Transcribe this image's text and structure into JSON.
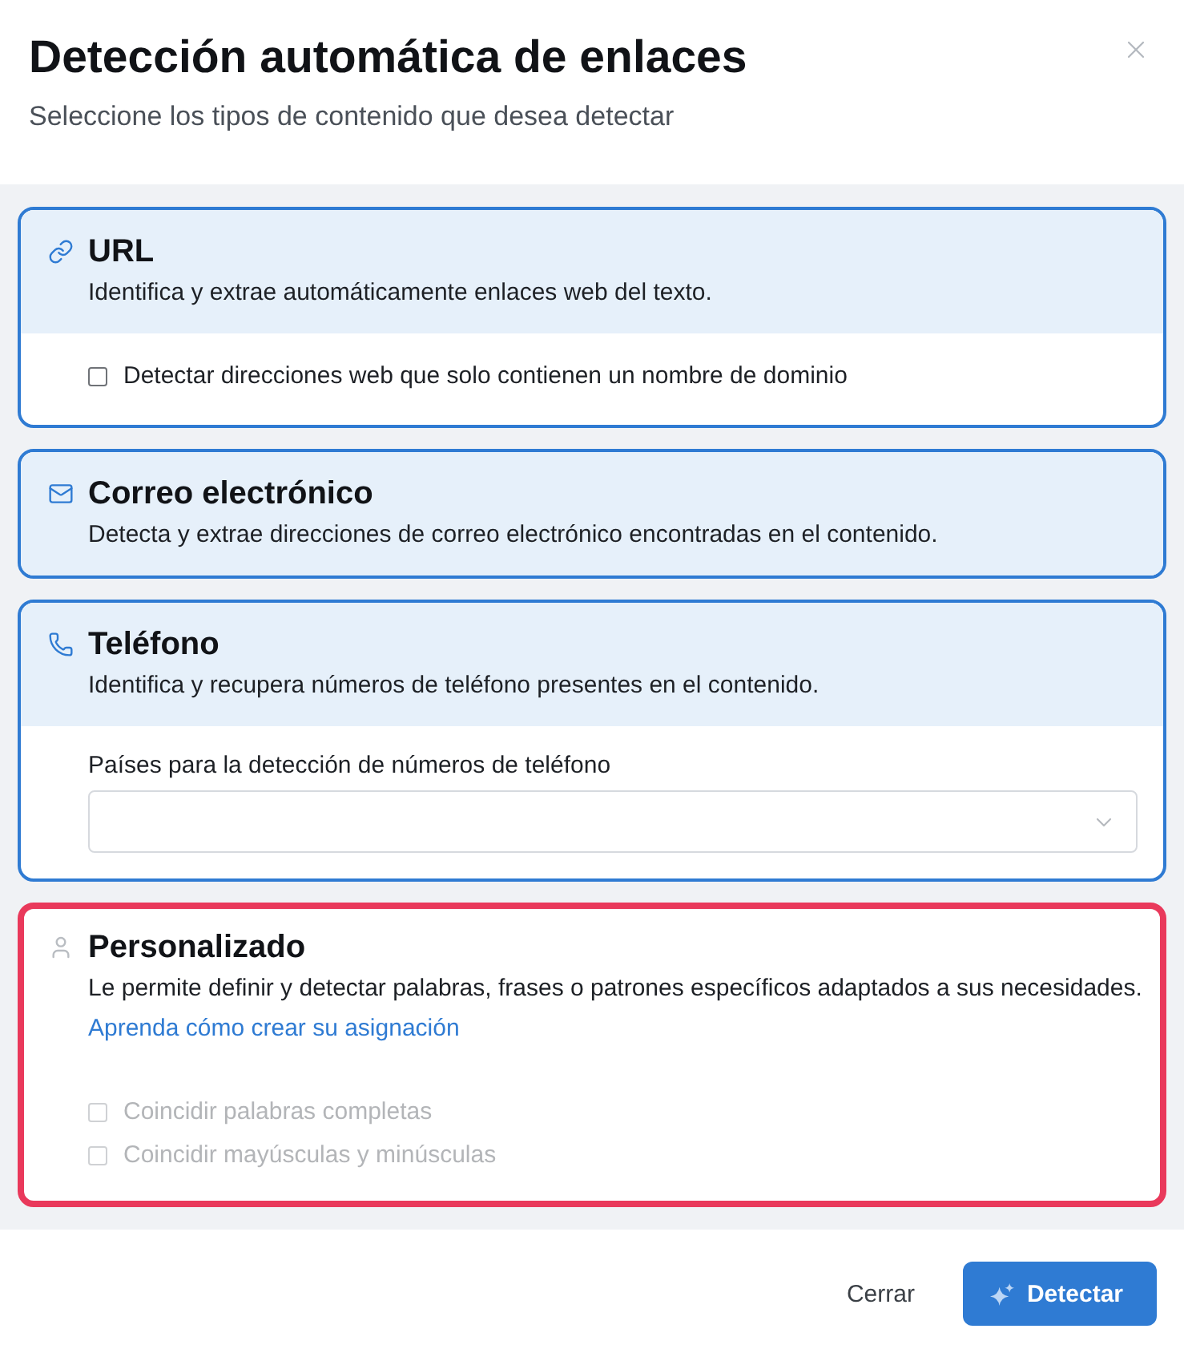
{
  "dialog": {
    "title": "Detección automática de enlaces",
    "subtitle": "Seleccione los tipos de contenido que desea detectar"
  },
  "sections": [
    {
      "kind": "url",
      "title": "URL",
      "description": "Identifica y extrae automáticamente enlaces web del texto.",
      "selected": true,
      "highlighted": false,
      "options": [
        {
          "label": "Detectar direcciones web que solo contienen un nombre de dominio",
          "checked": false,
          "disabled": false
        }
      ]
    },
    {
      "kind": "email",
      "title": "Correo electrónico",
      "description": "Detecta y extrae direcciones de correo electrónico encontradas en el contenido.",
      "selected": true,
      "highlighted": false
    },
    {
      "kind": "phone",
      "title": "Teléfono",
      "description": "Identifica y recupera números de teléfono presentes en el contenido.",
      "selected": true,
      "highlighted": false,
      "field": {
        "label": "Países para la detección de números de teléfono"
      }
    },
    {
      "kind": "custom",
      "title": "Personalizado",
      "description": "Le permite definir y detectar palabras, frases o patrones específicos adaptados a sus necesidades.",
      "link": "Aprenda cómo crear su asignación",
      "selected": false,
      "highlighted": true,
      "options": [
        {
          "label": "Coincidir palabras completas",
          "checked": false,
          "disabled": true
        },
        {
          "label": "Coincidir mayúsculas y minúsculas",
          "checked": false,
          "disabled": true
        }
      ]
    }
  ],
  "footer": {
    "buttons": [
      {
        "kind": "text",
        "label": "Cerrar"
      },
      {
        "kind": "primary",
        "label": "Detectar"
      }
    ]
  }
}
